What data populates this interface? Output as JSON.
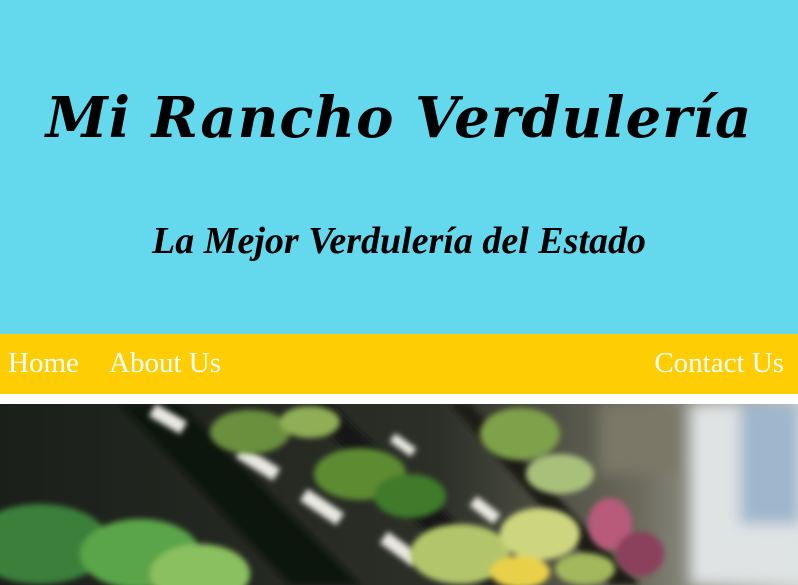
{
  "header": {
    "title": "Mi Rancho  Verdulería",
    "tagline": "La Mejor Verdulería del Estado",
    "background_color": "#64d9ed"
  },
  "nav": {
    "background_color": "#fecd03",
    "link_color": "#ffffff",
    "items": [
      {
        "label": "Home"
      },
      {
        "label": "About Us"
      },
      {
        "label": "Contact Us"
      }
    ]
  },
  "hero": {
    "subject": "blurred produce shelves in a grocery store"
  }
}
